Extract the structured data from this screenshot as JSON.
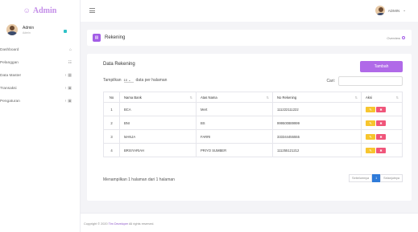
{
  "sidebar": {
    "brand": "Admin",
    "user": {
      "name": "Admin",
      "role": "Admin"
    },
    "items": [
      {
        "label": "Dashboard",
        "icon": "home-icon"
      },
      {
        "label": "Pelanggan",
        "icon": "users-icon"
      },
      {
        "label": "Data Master",
        "icon": "grid-icon",
        "has_children": true
      },
      {
        "label": "Transaksi",
        "icon": "cart-icon",
        "has_children": true
      },
      {
        "label": "Pengaturan",
        "icon": "settings-icon",
        "has_children": true
      }
    ]
  },
  "topbar": {
    "user_label": "ADMIN"
  },
  "page": {
    "title": "Rekening",
    "breadcrumb": "Overview"
  },
  "card": {
    "title": "Data Rekening",
    "add_label": "Tambah",
    "length_prefix": "Tampilkan",
    "length_value": "10",
    "length_suffix": "data per halaman",
    "search_label": "Cari:",
    "columns": [
      "No",
      "Nama Bank",
      "Atas Nama",
      "No Rekening",
      "Aksi"
    ],
    "rows": [
      {
        "no": "1",
        "bank": "BCA",
        "name": "Mert",
        "number": "111222111222"
      },
      {
        "no": "2",
        "bank": "BNI",
        "name": "BS",
        "number": "999500889999"
      },
      {
        "no": "3",
        "bank": "MANJA",
        "name": "FARRI",
        "number": "333344455555"
      },
      {
        "no": "4",
        "bank": "BRISYARIAH",
        "name": "PRIYO SUMBER",
        "number": "111255121212"
      }
    ],
    "info": "Menampilkan 1 halaman dari 1 halaman",
    "pager": {
      "prev": "Sebelumnya",
      "page": "1",
      "next": "Selanjutnya"
    }
  },
  "footer": {
    "text": "Copyright © 2020",
    "brand": "Tim Developer",
    "suffix": "All rights reserved."
  },
  "colors": {
    "accent": "#b06ae8",
    "edit": "#f7c52e",
    "delete": "#f0557a",
    "pager_active": "#2f7bd9"
  }
}
